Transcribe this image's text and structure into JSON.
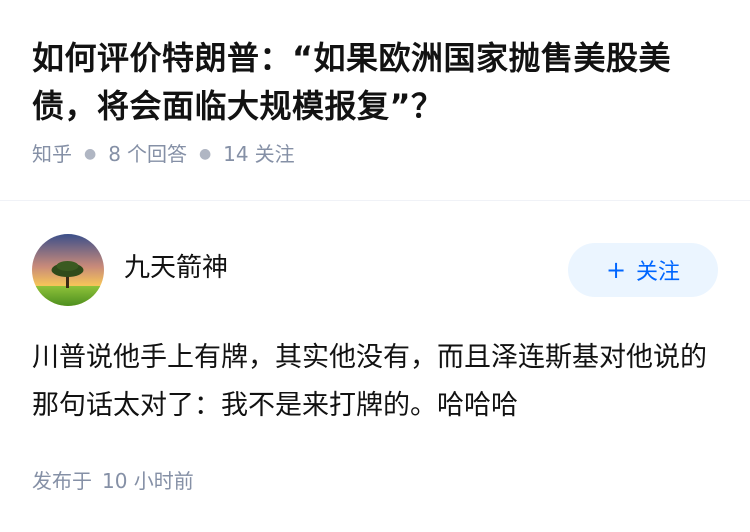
{
  "question": {
    "title": "如何评价特朗普：“如果欧洲国家抛售美股美债，将会面临大规模报复”？",
    "source": "知乎",
    "answer_count": "8",
    "answer_label": "个回答",
    "follower_count": "14",
    "follower_label": "关注"
  },
  "answer": {
    "author_name": "九天箭神",
    "follow_plus": "+",
    "follow_label": "关注",
    "content": "川普说他手上有牌，其实他没有，而且泽连斯基对他说的那句话太对了：我不是来打牌的。哈哈哈",
    "published_label": "发布于",
    "published_time": "10 小时前"
  },
  "colors": {
    "accent": "#0066ff",
    "follow_bg": "#ebf5ff",
    "meta_text": "#8590a6",
    "title_text": "#121212"
  }
}
